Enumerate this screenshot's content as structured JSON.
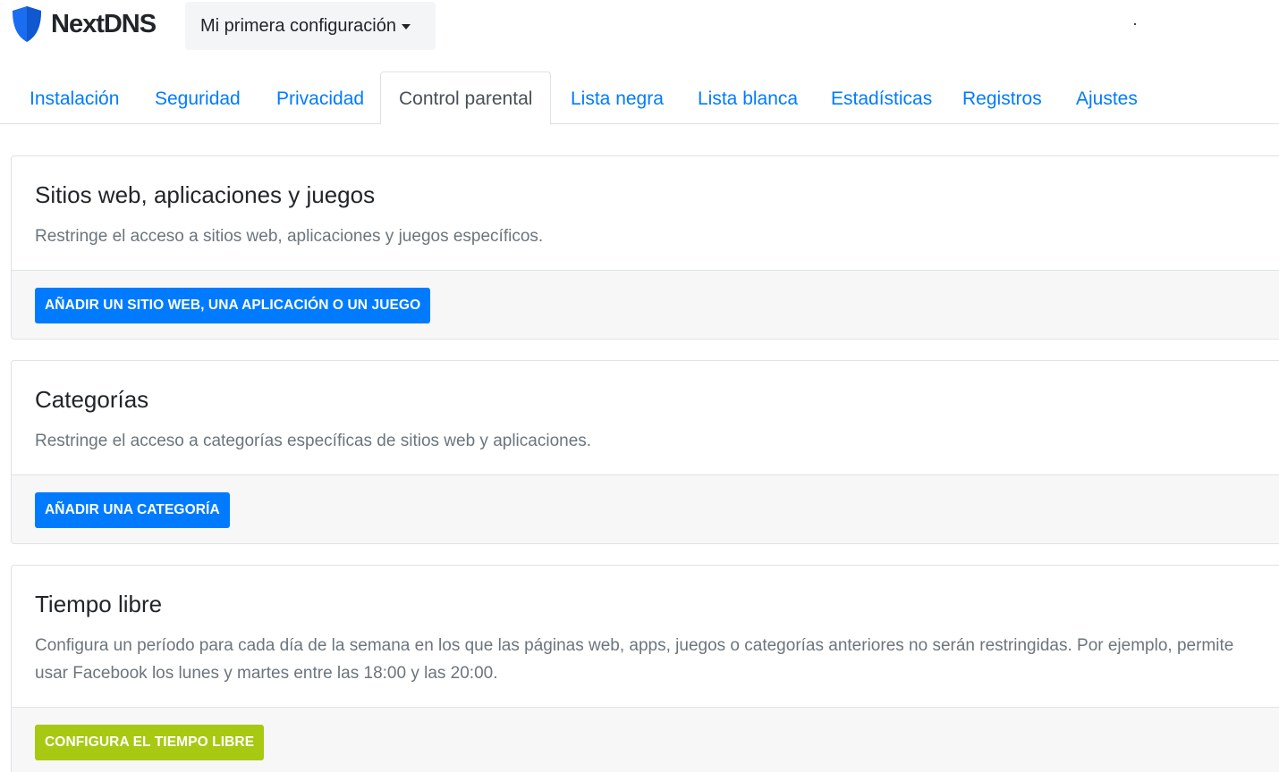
{
  "brand": {
    "name": "NextDNS",
    "logo_icon": "shield-icon",
    "color": "#1a6cf0"
  },
  "config_selector": {
    "label": "Mi primera configuración",
    "icon": "caret-down-icon"
  },
  "tabs": [
    {
      "label": "Instalación",
      "active": false
    },
    {
      "label": "Seguridad",
      "active": false
    },
    {
      "label": "Privacidad",
      "active": false
    },
    {
      "label": "Control parental",
      "active": true
    },
    {
      "label": "Lista negra",
      "active": false
    },
    {
      "label": "Lista blanca",
      "active": false
    },
    {
      "label": "Estadísticas",
      "active": false
    },
    {
      "label": "Registros",
      "active": false
    },
    {
      "label": "Ajustes",
      "active": false
    }
  ],
  "sections": [
    {
      "title": "Sitios web, aplicaciones y juegos",
      "description": "Restringe el acceso a sitios web, aplicaciones y juegos específicos.",
      "button": "Añadir un sitio web, una aplicación o un juego"
    },
    {
      "title": "Categorías",
      "description": "Restringe el acceso a categorías específicas de sitios web y aplicaciones.",
      "button": "Añadir una categoría"
    },
    {
      "title": "Tiempo libre",
      "description": "Configura un período para cada día de la semana en los que las páginas web, apps, juegos o categorías anteriores no serán restringidas. Por ejemplo, permite usar Facebook los lunes y martes entre las 18:00 y las 20:00.",
      "button": "Configura el tiempo libre"
    }
  ],
  "colors": {
    "link": "#007bff",
    "primary_button": "#007bff",
    "recreation_button": "#a7c912"
  }
}
